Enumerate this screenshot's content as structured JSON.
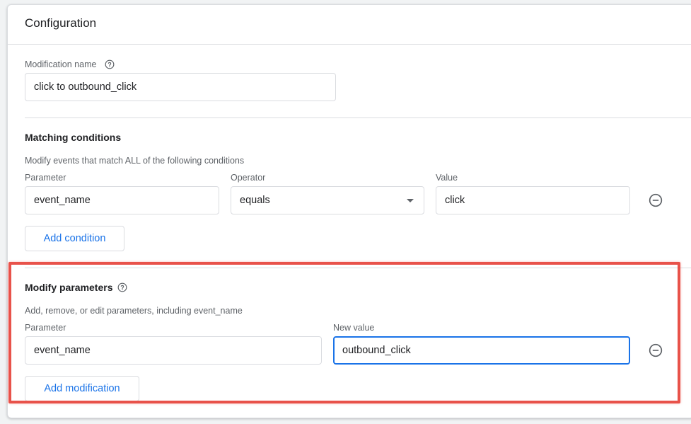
{
  "configuration": {
    "title": "Configuration"
  },
  "modification_name": {
    "label": "Modification name",
    "value": "click to outbound_click"
  },
  "matching_conditions": {
    "title": "Matching conditions",
    "description": "Modify events that match ALL of the following conditions",
    "parameter_label": "Parameter",
    "operator_label": "Operator",
    "value_label": "Value",
    "rows": [
      {
        "parameter": "event_name",
        "operator": "equals",
        "value": "click"
      }
    ],
    "add_button": "Add condition"
  },
  "modify_parameters": {
    "title": "Modify parameters",
    "description": "Add, remove, or edit parameters, including event_name",
    "parameter_label": "Parameter",
    "new_value_label": "New value",
    "rows": [
      {
        "parameter": "event_name",
        "new_value": "outbound_click"
      }
    ],
    "add_button": "Add modification"
  },
  "colors": {
    "accent": "#1a73e8",
    "highlight": "#e8524a",
    "border": "#dadce0",
    "secondary_text": "#5f6368"
  },
  "icons": [
    "help-circle-icon",
    "remove-circle-icon",
    "dropdown-caret-icon"
  ]
}
